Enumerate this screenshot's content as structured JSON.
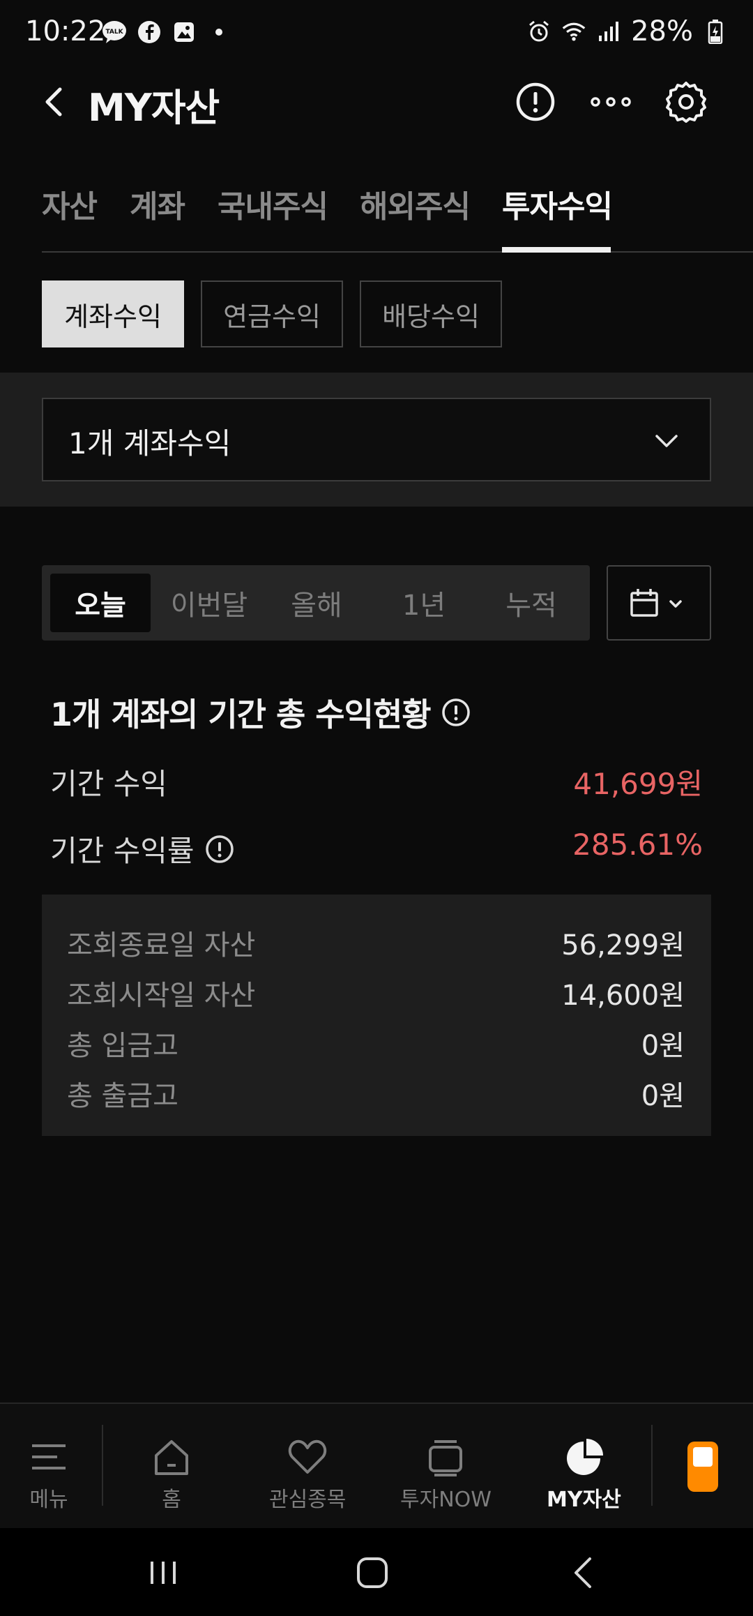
{
  "status_bar": {
    "time": "10:22",
    "battery": "28%"
  },
  "header": {
    "title": "MY자산"
  },
  "tabs": [
    {
      "label": "자산"
    },
    {
      "label": "계좌"
    },
    {
      "label": "국내주식"
    },
    {
      "label": "해외주식"
    },
    {
      "label": "투자수익",
      "active": true
    }
  ],
  "subtabs": [
    {
      "label": "계좌수익",
      "active": true
    },
    {
      "label": "연금수익"
    },
    {
      "label": "배당수익"
    }
  ],
  "account_selector": {
    "label": "1개 계좌수익"
  },
  "period": {
    "options": [
      "오늘",
      "이번달",
      "올해",
      "1년",
      "누적"
    ],
    "selected": "오늘"
  },
  "summary": {
    "title": "1개 계좌의 기간 총 수익현황",
    "profit_label": "기간 수익",
    "profit_value": "41,699원",
    "rate_label": "기간 수익률",
    "rate_value": "285.61%"
  },
  "details": [
    {
      "label": "조회종료일 자산",
      "value": "56,299원"
    },
    {
      "label": "조회시작일 자산",
      "value": "14,600원"
    },
    {
      "label": "총 입금고",
      "value": "0원"
    },
    {
      "label": "총 출금고",
      "value": "0원"
    }
  ],
  "bottom_nav": [
    {
      "label": "메뉴",
      "icon": "menu-icon"
    },
    {
      "label": "홈",
      "icon": "home-icon"
    },
    {
      "label": "관심종목",
      "icon": "heart-icon"
    },
    {
      "label": "투자NOW",
      "icon": "tv-icon"
    },
    {
      "label": "MY자산",
      "icon": "pie-chart-icon",
      "active": true
    }
  ],
  "colors": {
    "profit": "#e86464",
    "accent": "#ff8a00",
    "background": "#0b0b0b"
  }
}
